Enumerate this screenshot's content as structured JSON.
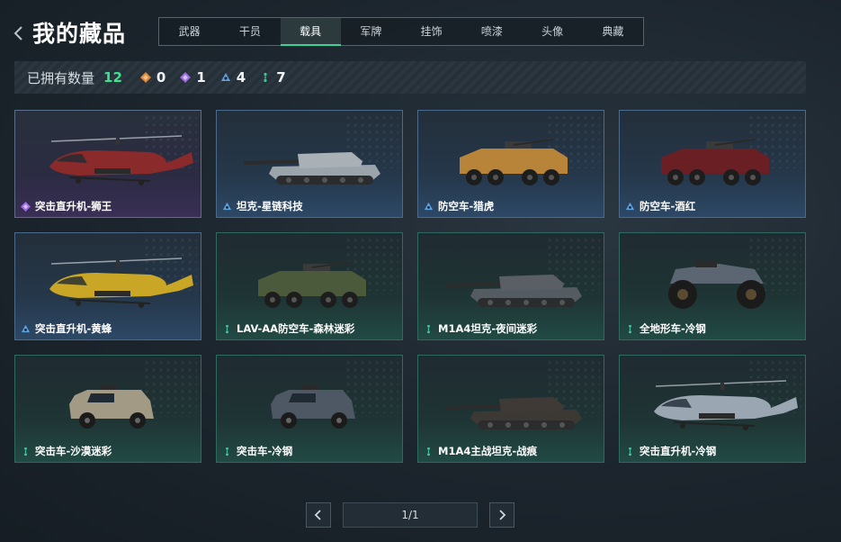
{
  "header": {
    "title": "我的藏品"
  },
  "tabs": [
    {
      "label": "武器",
      "active": false
    },
    {
      "label": "干员",
      "active": false
    },
    {
      "label": "载具",
      "active": true
    },
    {
      "label": "军牌",
      "active": false
    },
    {
      "label": "挂饰",
      "active": false
    },
    {
      "label": "喷漆",
      "active": false
    },
    {
      "label": "头像",
      "active": false
    },
    {
      "label": "典藏",
      "active": false
    }
  ],
  "summary": {
    "label": "已拥有数量",
    "total": "12",
    "rarities": [
      {
        "icon": "orange-diamond-icon",
        "color": "#e0883a",
        "count": "0"
      },
      {
        "icon": "purple-diamond-icon",
        "color": "#9b6be0",
        "count": "1"
      },
      {
        "icon": "blue-triangle-icon",
        "color": "#5ea3e0",
        "count": "4"
      },
      {
        "icon": "green-dots-icon",
        "color": "#3ec79a",
        "count": "7"
      }
    ]
  },
  "items": [
    {
      "name": "突击直升机-狮王",
      "rarity": "purple",
      "kind": "heli",
      "color": "#8a2a2a"
    },
    {
      "name": "坦克-星链科技",
      "rarity": "blue",
      "kind": "tank",
      "color": "#a9b0b6"
    },
    {
      "name": "防空车-猎虎",
      "rarity": "blue",
      "kind": "apc",
      "color": "#b7843a"
    },
    {
      "name": "防空车-酒红",
      "rarity": "blue",
      "kind": "apc",
      "color": "#6a1f24"
    },
    {
      "name": "突击直升机-黄蜂",
      "rarity": "blue",
      "kind": "heli",
      "color": "#c9a626"
    },
    {
      "name": "LAV-AA防空车-森林迷彩",
      "rarity": "green",
      "kind": "apc",
      "color": "#4b5a3a"
    },
    {
      "name": "M1A4坦克-夜间迷彩",
      "rarity": "green",
      "kind": "tank",
      "color": "#5a5f66"
    },
    {
      "name": "全地形车-冷钢",
      "rarity": "green",
      "kind": "atv",
      "color": "#5c6672"
    },
    {
      "name": "突击车-沙漠迷彩",
      "rarity": "green",
      "kind": "truck",
      "color": "#a39a86"
    },
    {
      "name": "突击车-冷钢",
      "rarity": "green",
      "kind": "truck",
      "color": "#4e5864"
    },
    {
      "name": "M1A4主战坦克-战痕",
      "rarity": "green",
      "kind": "tank",
      "color": "#3f3a35"
    },
    {
      "name": "突击直升机-冷钢",
      "rarity": "green",
      "kind": "heli",
      "color": "#9aa6b2"
    }
  ],
  "pagination": {
    "page": "1/1",
    "prev_icon": "chevron-left-icon",
    "next_icon": "chevron-right-icon"
  }
}
